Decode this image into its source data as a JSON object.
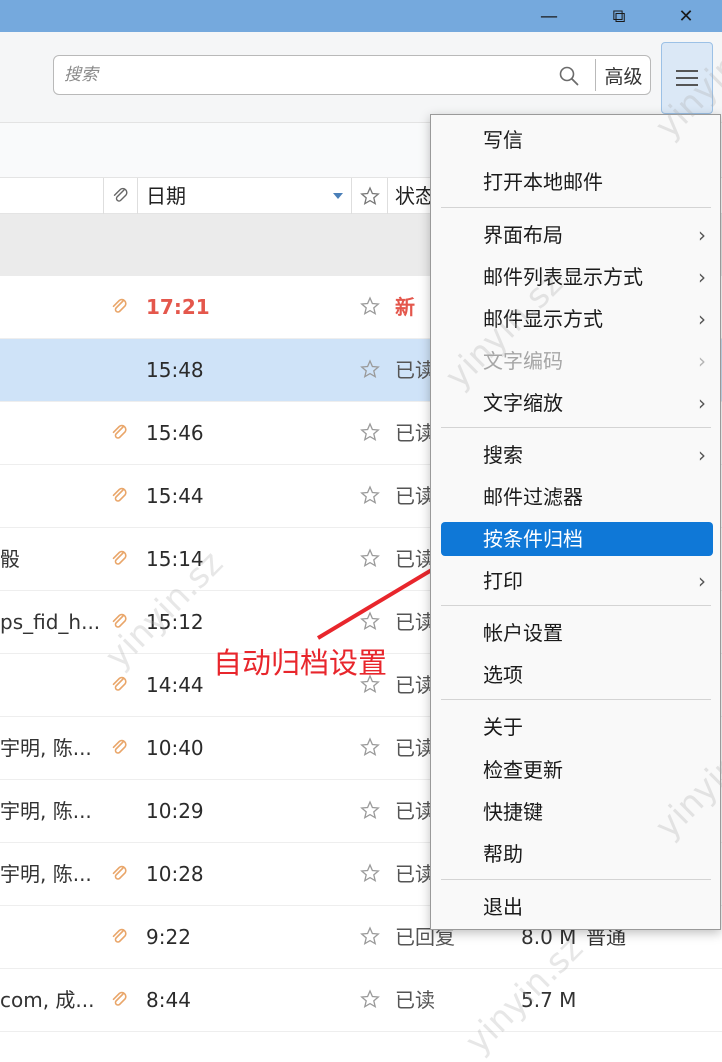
{
  "window": {
    "minimize_glyph": "—",
    "restore_glyph": "⧉",
    "close_glyph": "✕"
  },
  "search": {
    "placeholder": "搜索",
    "advanced_label": "高级"
  },
  "columns": {
    "date_label": "日期",
    "status_label": "状态"
  },
  "rows": [
    {
      "subject": "",
      "time": "17:21",
      "status": "新",
      "attachment": true,
      "unread": true,
      "selected": false
    },
    {
      "subject": "",
      "time": "15:48",
      "status": "已读",
      "attachment": false,
      "unread": false,
      "selected": true
    },
    {
      "subject": "",
      "time": "15:46",
      "status": "已读",
      "attachment": true,
      "unread": false,
      "selected": false
    },
    {
      "subject": "",
      "time": "15:44",
      "status": "已读",
      "attachment": true,
      "unread": false,
      "selected": false
    },
    {
      "subject": "骰",
      "time": "15:14",
      "status": "已读",
      "attachment": true,
      "unread": false,
      "selected": false
    },
    {
      "subject": "ps_fid_h...",
      "time": "15:12",
      "status": "已读",
      "attachment": true,
      "unread": false,
      "selected": false
    },
    {
      "subject": "",
      "time": "14:44",
      "status": "已读",
      "attachment": true,
      "unread": false,
      "selected": false
    },
    {
      "subject": "宇明, 陈...",
      "time": "10:40",
      "status": "已读",
      "attachment": true,
      "unread": false,
      "selected": false
    },
    {
      "subject": "宇明, 陈...",
      "time": "10:29",
      "status": "已读",
      "attachment": false,
      "unread": false,
      "selected": false
    },
    {
      "subject": "宇明, 陈...",
      "time": "10:28",
      "status": "已读",
      "attachment": true,
      "unread": false,
      "selected": false
    },
    {
      "subject": "",
      "time": "9:22",
      "status": "已回复",
      "size": "8.0 M",
      "priority": "普通",
      "attachment": true,
      "unread": false,
      "selected": false
    },
    {
      "subject": "com, 成...",
      "time": "8:44",
      "status": "已读",
      "size": "5.7 M",
      "priority": "",
      "attachment": true,
      "unread": false,
      "selected": false
    }
  ],
  "menu": {
    "items": [
      {
        "label": "写信",
        "submenu": false,
        "disabled": false
      },
      {
        "label": "打开本地邮件",
        "submenu": false,
        "disabled": false
      },
      {
        "label": "界面布局",
        "submenu": true,
        "disabled": false
      },
      {
        "label": "邮件列表显示方式",
        "submenu": true,
        "disabled": false
      },
      {
        "label": "邮件显示方式",
        "submenu": true,
        "disabled": false
      },
      {
        "label": "文字编码",
        "submenu": true,
        "disabled": true
      },
      {
        "label": "文字缩放",
        "submenu": true,
        "disabled": false
      },
      {
        "label": "搜索",
        "submenu": true,
        "disabled": false
      },
      {
        "label": "邮件过滤器",
        "submenu": false,
        "disabled": false
      },
      {
        "label": "按条件归档",
        "submenu": false,
        "disabled": false,
        "highlighted": true
      },
      {
        "label": "打印",
        "submenu": true,
        "disabled": false
      },
      {
        "label": "帐户设置",
        "submenu": false,
        "disabled": false
      },
      {
        "label": "选项",
        "submenu": false,
        "disabled": false
      },
      {
        "label": "关于",
        "submenu": false,
        "disabled": false
      },
      {
        "label": "检查更新",
        "submenu": false,
        "disabled": false
      },
      {
        "label": "快捷键",
        "submenu": false,
        "disabled": false
      },
      {
        "label": "帮助",
        "submenu": false,
        "disabled": false
      },
      {
        "label": "退出",
        "submenu": false,
        "disabled": false
      }
    ]
  },
  "annotation": {
    "text": "自动归档设置"
  },
  "watermark": {
    "text": "yinyin.sz"
  },
  "colors": {
    "titlebar": "#75a9dd",
    "selected_row": "#cfe3f8",
    "highlight": "#0f78d7",
    "new_mail": "#e4574c",
    "annotation": "#e8262c"
  }
}
